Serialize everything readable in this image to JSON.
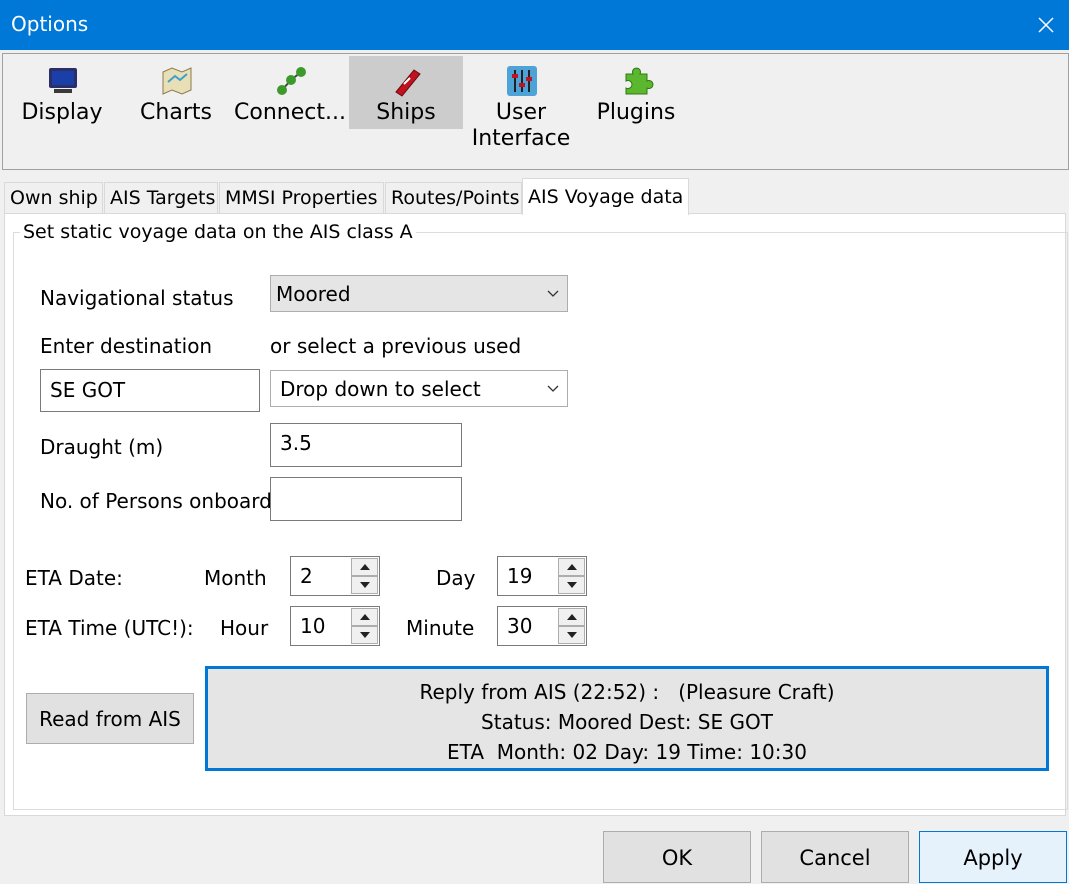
{
  "window": {
    "title": "Options"
  },
  "toolbar": {
    "items": [
      {
        "label": "Display",
        "icon": "monitor-icon"
      },
      {
        "label": "Charts",
        "icon": "chart-map-icon"
      },
      {
        "label": "Connect...",
        "icon": "connection-nodes-icon"
      },
      {
        "label": "Ships",
        "icon": "ship-icon",
        "selected": true
      },
      {
        "label": "User Interface",
        "icon": "sliders-icon"
      },
      {
        "label": "Plugins",
        "icon": "puzzle-piece-icon"
      }
    ]
  },
  "tabs": [
    "Own ship",
    "AIS Targets",
    "MMSI Properties",
    "Routes/Points",
    "AIS Voyage data"
  ],
  "active_tab": "AIS Voyage data",
  "voyage": {
    "group_title": "Set static voyage data on the AIS class A",
    "nav_status_label": "Navigational status",
    "nav_status_value": "Moored",
    "enter_destination_label": "Enter destination",
    "select_previous_label": "or select a previous used",
    "destination_value": "SE GOT",
    "previous_dropdown_value": "Drop down to select",
    "draught_label": "Draught (m)",
    "draught_value": "3.5",
    "persons_label": "No. of Persons onboard",
    "persons_value": "",
    "eta_date_label": "ETA Date:",
    "month_label": "Month",
    "month_value": "2",
    "day_label": "Day",
    "day_value": "19",
    "eta_time_label": "ETA Time (UTC!):",
    "hour_label": "Hour",
    "hour_value": "10",
    "minute_label": "Minute",
    "minute_value": "30",
    "read_button": "Read from AIS",
    "reply_line1": "Reply from AIS (22:52) :   (Pleasure Craft)",
    "reply_line2": "Status: Moored Dest: SE GOT",
    "reply_line3": "ETA  Month: 02 Day: 19 Time: 10:30"
  },
  "footer": {
    "ok": "OK",
    "cancel": "Cancel",
    "apply": "Apply"
  },
  "colors": {
    "titlebar": "#0078d7",
    "selected_tool": "#cccccc",
    "focus_border": "#0078d7"
  }
}
